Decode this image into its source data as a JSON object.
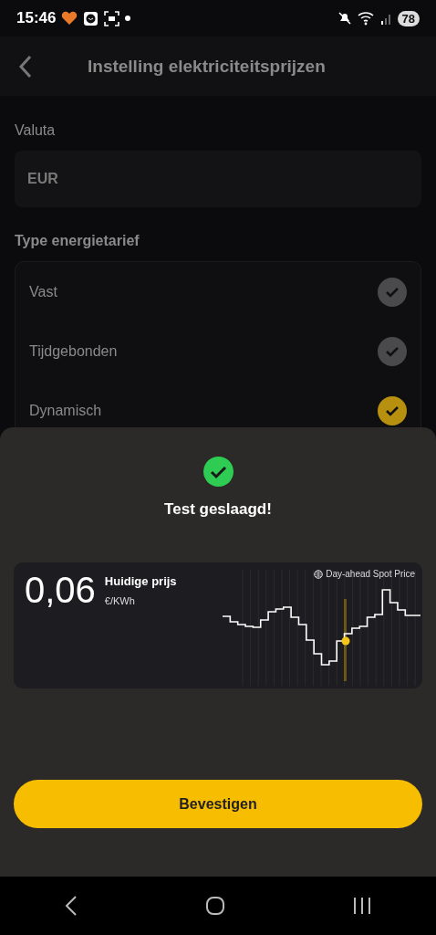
{
  "status_bar": {
    "time": "15:46",
    "battery": "78"
  },
  "header": {
    "title": "Instelling elektriciteitsprijzen"
  },
  "currency": {
    "label": "Valuta",
    "value": "EUR"
  },
  "tariff": {
    "label": "Type energietarief",
    "options": [
      {
        "label": "Vast",
        "selected": false
      },
      {
        "label": "Tijdgebonden",
        "selected": false
      },
      {
        "label": "Dynamisch",
        "selected": true
      }
    ]
  },
  "sheet": {
    "title": "Test geslaagd!",
    "price": {
      "value": "0,06",
      "label": "Huidige prijs",
      "unit": "€/KWh",
      "source": "Day-ahead Spot Price"
    },
    "confirm_button": "Bevestigen"
  }
}
